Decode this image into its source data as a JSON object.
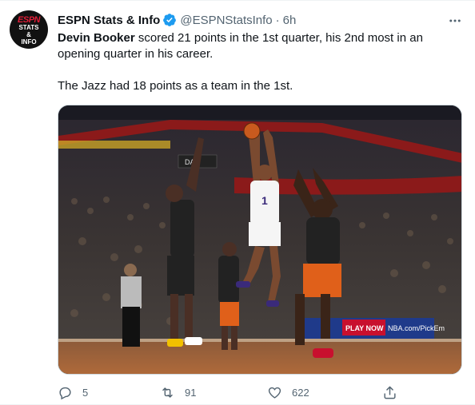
{
  "tweet": {
    "author_name": "ESPN Stats & Info",
    "author_handle": "@ESPNStatsInfo",
    "separator": "·",
    "time": "6h",
    "avatar": {
      "logo_text": "ESPN",
      "sub_text_1": "STATS",
      "sub_text_2": "&",
      "sub_text_3": "INFO"
    },
    "text_line1_name": "Devin Booker",
    "text_line1_rest": " scored 21 points in the 1st quarter, his 2nd most in an opening quarter in his career.",
    "text_line2": "The Jazz had 18 points as a team in the 1st.",
    "media_scene": {
      "baseline_ad_1": "PLAY NOW",
      "baseline_ad_2": "NBA.com/PickEm",
      "jersey_number": "1",
      "scoreboard": "DAL"
    },
    "actions": {
      "reply_count": "5",
      "retweet_count": "91",
      "like_count": "622"
    },
    "colors": {
      "accent": "#1d9bf0",
      "secondary_text": "#536471",
      "espn_red": "#e21d38"
    }
  }
}
